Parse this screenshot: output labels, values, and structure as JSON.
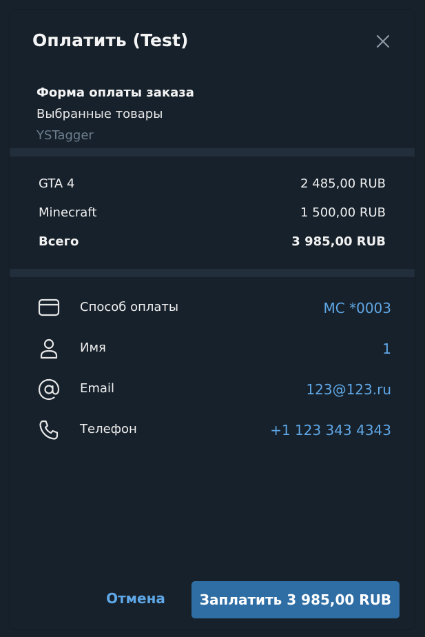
{
  "dialog": {
    "title": "Оплатить (Test)",
    "close_icon": "close-icon"
  },
  "invoice": {
    "title": "Форма оплаты заказа",
    "description": "Выбранные товары",
    "bot_name": "YSTagger"
  },
  "prices": [
    {
      "label": "GTA 4",
      "amount": "2 485,00 RUB"
    },
    {
      "label": "Minecraft",
      "amount": "1 500,00 RUB"
    }
  ],
  "total": {
    "label": "Всего",
    "amount": "3 985,00 RUB"
  },
  "info": {
    "payment_method": {
      "icon": "credit-card-icon",
      "label": "Способ оплаты",
      "value": "MC *0003"
    },
    "name": {
      "icon": "user-icon",
      "label": "Имя",
      "value": "1"
    },
    "email": {
      "icon": "at-sign-icon",
      "label": "Email",
      "value": "123@123.ru"
    },
    "phone": {
      "icon": "phone-icon",
      "label": "Телефон",
      "value": "+1 123 343 4343"
    }
  },
  "actions": {
    "cancel_label": "Отмена",
    "pay_label": "Заплатить 3 985,00 RUB"
  },
  "colors": {
    "background": "#17212b",
    "divider": "#232e3c",
    "accent": "#5fa7e6",
    "pay_button": "#2f6ea5",
    "secondary_text": "#6d7f8f"
  }
}
